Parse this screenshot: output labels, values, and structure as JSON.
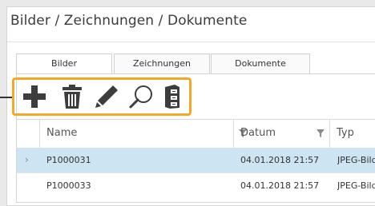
{
  "window": {
    "title": "Bilder / Zeichnungen / Dokumente"
  },
  "tabs": [
    {
      "label": "Bilder",
      "active": true
    },
    {
      "label": "Zeichnungen",
      "active": false
    },
    {
      "label": "Dokumente",
      "active": false
    }
  ],
  "toolbar": {
    "highlight_color": "#f3a82a",
    "icons": [
      "add-icon",
      "trash-icon",
      "pencil-icon",
      "search-icon",
      "file-cabinet-icon"
    ]
  },
  "grid": {
    "columns": [
      "Name",
      "Datum",
      "Typ"
    ],
    "rows": [
      {
        "expander": "›",
        "name": "P1000031",
        "datum": "04.01.2018 21:57",
        "typ": "JPEG-Bild",
        "selected": true
      },
      {
        "expander": "",
        "name": "P1000033",
        "datum": "04.01.2018 21:57",
        "typ": "JPEG-Bild",
        "selected": false
      }
    ]
  },
  "colors": {
    "selected_row": "#cde4f2",
    "icon": "#3d3d3d"
  }
}
